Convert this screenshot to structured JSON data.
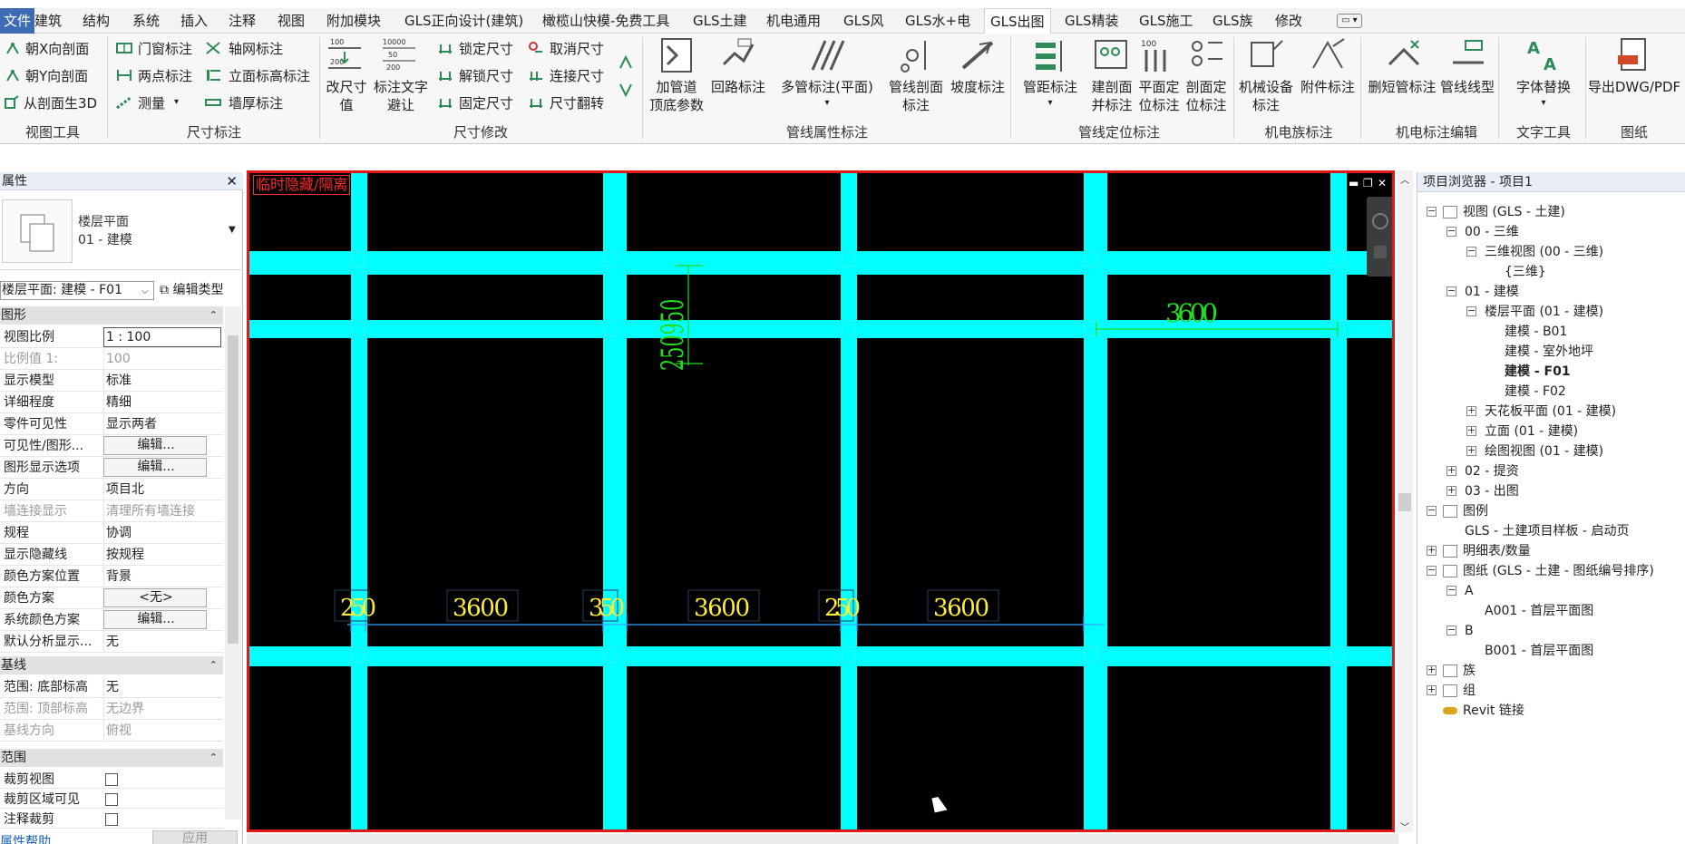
{
  "menu": {
    "file": "文件",
    "tabs": [
      "建筑",
      "结构",
      "系统",
      "插入",
      "注释",
      "视图",
      "附加模块",
      "GLS正向设计(建筑)",
      "橄榄山快模-免费工具",
      "GLS土建",
      "机电通用",
      "GLS风",
      "GLS水+电",
      "GLS出图",
      "GLS精装",
      "GLS施工",
      "GLS族",
      "修改"
    ],
    "active_tab": "GLS出图",
    "dropdown": "▭ ▾"
  },
  "ribbon": {
    "groups": {
      "view_tools": "视图工具",
      "dim_annot": "尺寸标注",
      "dim_modify": "尺寸修改",
      "pipe_attr": "管线属性标注",
      "pipe_pos": "管线定位标注",
      "mep_family": "机电族标注",
      "mep_edit": "机电标注编辑",
      "text_tools": "文字工具",
      "sheet": "图纸"
    },
    "view_tools": [
      "朝X向剖面",
      "朝Y向剖面",
      "从剖面生3D"
    ],
    "dim_annot_col1": [
      "门窗标注",
      "两点标注",
      "测量"
    ],
    "dim_annot_col2": [
      "轴网标注",
      "立面标高标注",
      "墙厚标注"
    ],
    "dim_mod_big": [
      [
        "改尺寸",
        "值"
      ],
      [
        "标注文字",
        "避让"
      ]
    ],
    "dim_mod_col1": [
      "锁定尺寸",
      "解锁尺寸",
      "固定尺寸"
    ],
    "dim_mod_col2": [
      "取消尺寸",
      "连接尺寸",
      "尺寸翻转"
    ],
    "pipe_attr_big": [
      [
        "加管道",
        "顶底参数"
      ],
      [
        "回路标注"
      ],
      [
        "多管标注(平面)"
      ],
      [
        "管线剖面",
        "标注"
      ],
      [
        "坡度标注"
      ]
    ],
    "pipe_pos_big": [
      [
        "管距标注"
      ],
      [
        "建剖面",
        "并标注"
      ],
      [
        "平面定",
        "位标注"
      ],
      [
        "剖面定",
        "位标注"
      ]
    ],
    "mep_family_big": [
      [
        "机械设备",
        "标注"
      ],
      [
        "附件标注"
      ]
    ],
    "mep_edit_big": [
      [
        "删短管标注"
      ],
      [
        "管线线型"
      ]
    ],
    "text_big": [
      [
        "字体替换"
      ]
    ],
    "sheet_big": [
      [
        "导出DWG/PDF"
      ]
    ]
  },
  "properties": {
    "title": "属性",
    "type_line1": "楼层平面",
    "type_line2": "01 - 建模",
    "selector": "楼层平面: 建模 - F01",
    "edit_type": "编辑类型",
    "sections": {
      "graphics": "图形",
      "underlay": "基线",
      "extents": "范围"
    },
    "rows_graphics": [
      {
        "k": "视图比例",
        "v": "1 : 100",
        "style": "input"
      },
      {
        "k": "比例值 1:",
        "v": "100",
        "style": "dis"
      },
      {
        "k": "显示模型",
        "v": "标准"
      },
      {
        "k": "详细程度",
        "v": "精细"
      },
      {
        "k": "零件可见性",
        "v": "显示两者"
      },
      {
        "k": "可见性/图形...",
        "v": "编辑...",
        "style": "btn"
      },
      {
        "k": "图形显示选项",
        "v": "编辑...",
        "style": "btn"
      },
      {
        "k": "方向",
        "v": "项目北"
      },
      {
        "k": "墙连接显示",
        "v": "清理所有墙连接",
        "style": "dis"
      },
      {
        "k": "规程",
        "v": "协调"
      },
      {
        "k": "显示隐藏线",
        "v": "按规程"
      },
      {
        "k": "颜色方案位置",
        "v": "背景"
      },
      {
        "k": "颜色方案",
        "v": "<无>",
        "style": "btn"
      },
      {
        "k": "系统颜色方案",
        "v": "编辑...",
        "style": "btn"
      },
      {
        "k": "默认分析显示...",
        "v": "无"
      }
    ],
    "rows_underlay": [
      {
        "k": "范围: 底部标高",
        "v": "无"
      },
      {
        "k": "范围: 顶部标高",
        "v": "无边界",
        "style": "dis"
      },
      {
        "k": "基线方向",
        "v": "俯视",
        "style": "dis"
      }
    ],
    "rows_extents": [
      {
        "k": "裁剪视图",
        "v": "",
        "style": "chk"
      },
      {
        "k": "裁剪区域可见",
        "v": "",
        "style": "chk"
      },
      {
        "k": "注释裁剪",
        "v": "",
        "style": "chk"
      }
    ],
    "help": "属性帮助",
    "apply": "应用"
  },
  "canvas": {
    "tag": "临时隐藏/隔离",
    "colors": {
      "grid": "#00ffff",
      "dim_green": "#22dd22",
      "dim_yellow": "#ffee33",
      "dim_line": "#3aa0ff"
    },
    "dims": {
      "vertical": "250950",
      "top_right": "3600",
      "bottom": [
        "250",
        "3600",
        "350",
        "3600",
        "250",
        "3600"
      ]
    }
  },
  "browser": {
    "title": "项目浏览器 - 项目1",
    "nodes": [
      {
        "label": "视图 (GLS - 土建)",
        "level": 0,
        "box": "−",
        "icon": "views"
      },
      {
        "label": "00 - 三维",
        "level": 1,
        "box": "−"
      },
      {
        "label": "三维视图 (00 - 三维)",
        "level": 2,
        "box": "−"
      },
      {
        "label": "{三维}",
        "level": 3
      },
      {
        "label": "01 - 建模",
        "level": 1,
        "box": "−"
      },
      {
        "label": "楼层平面 (01 - 建模)",
        "level": 2,
        "box": "−"
      },
      {
        "label": "建模 - B01",
        "level": 3
      },
      {
        "label": "建模 - 室外地坪",
        "level": 3
      },
      {
        "label": "建模 - F01",
        "level": 3,
        "bold": true
      },
      {
        "label": "建模 - F02",
        "level": 3
      },
      {
        "label": "天花板平面 (01 - 建模)",
        "level": 2,
        "box": "+"
      },
      {
        "label": "立面 (01 - 建模)",
        "level": 2,
        "box": "+"
      },
      {
        "label": "绘图视图 (01 - 建模)",
        "level": 2,
        "box": "+"
      },
      {
        "label": "02 - 提资",
        "level": 1,
        "box": "+"
      },
      {
        "label": "03 - 出图",
        "level": 1,
        "box": "+"
      },
      {
        "label": "图例",
        "level": 0,
        "box": "−",
        "icon": "legend"
      },
      {
        "label": "GLS - 土建项目样板 - 启动页",
        "level": 1
      },
      {
        "label": "明细表/数量",
        "level": 0,
        "box": "+",
        "icon": "schedule"
      },
      {
        "label": "图纸 (GLS - 土建 - 图纸编号排序)",
        "level": 0,
        "box": "−",
        "icon": "sheet"
      },
      {
        "label": "A",
        "level": 1,
        "box": "−"
      },
      {
        "label": "A001 - 首层平面图",
        "level": 2
      },
      {
        "label": "B",
        "level": 1,
        "box": "−"
      },
      {
        "label": "B001 - 首层平面图",
        "level": 2
      },
      {
        "label": "族",
        "level": 0,
        "box": "+",
        "icon": "family"
      },
      {
        "label": "组",
        "level": 0,
        "box": "+",
        "icon": "group"
      },
      {
        "label": "Revit 链接",
        "level": 0,
        "icon": "link"
      }
    ]
  }
}
